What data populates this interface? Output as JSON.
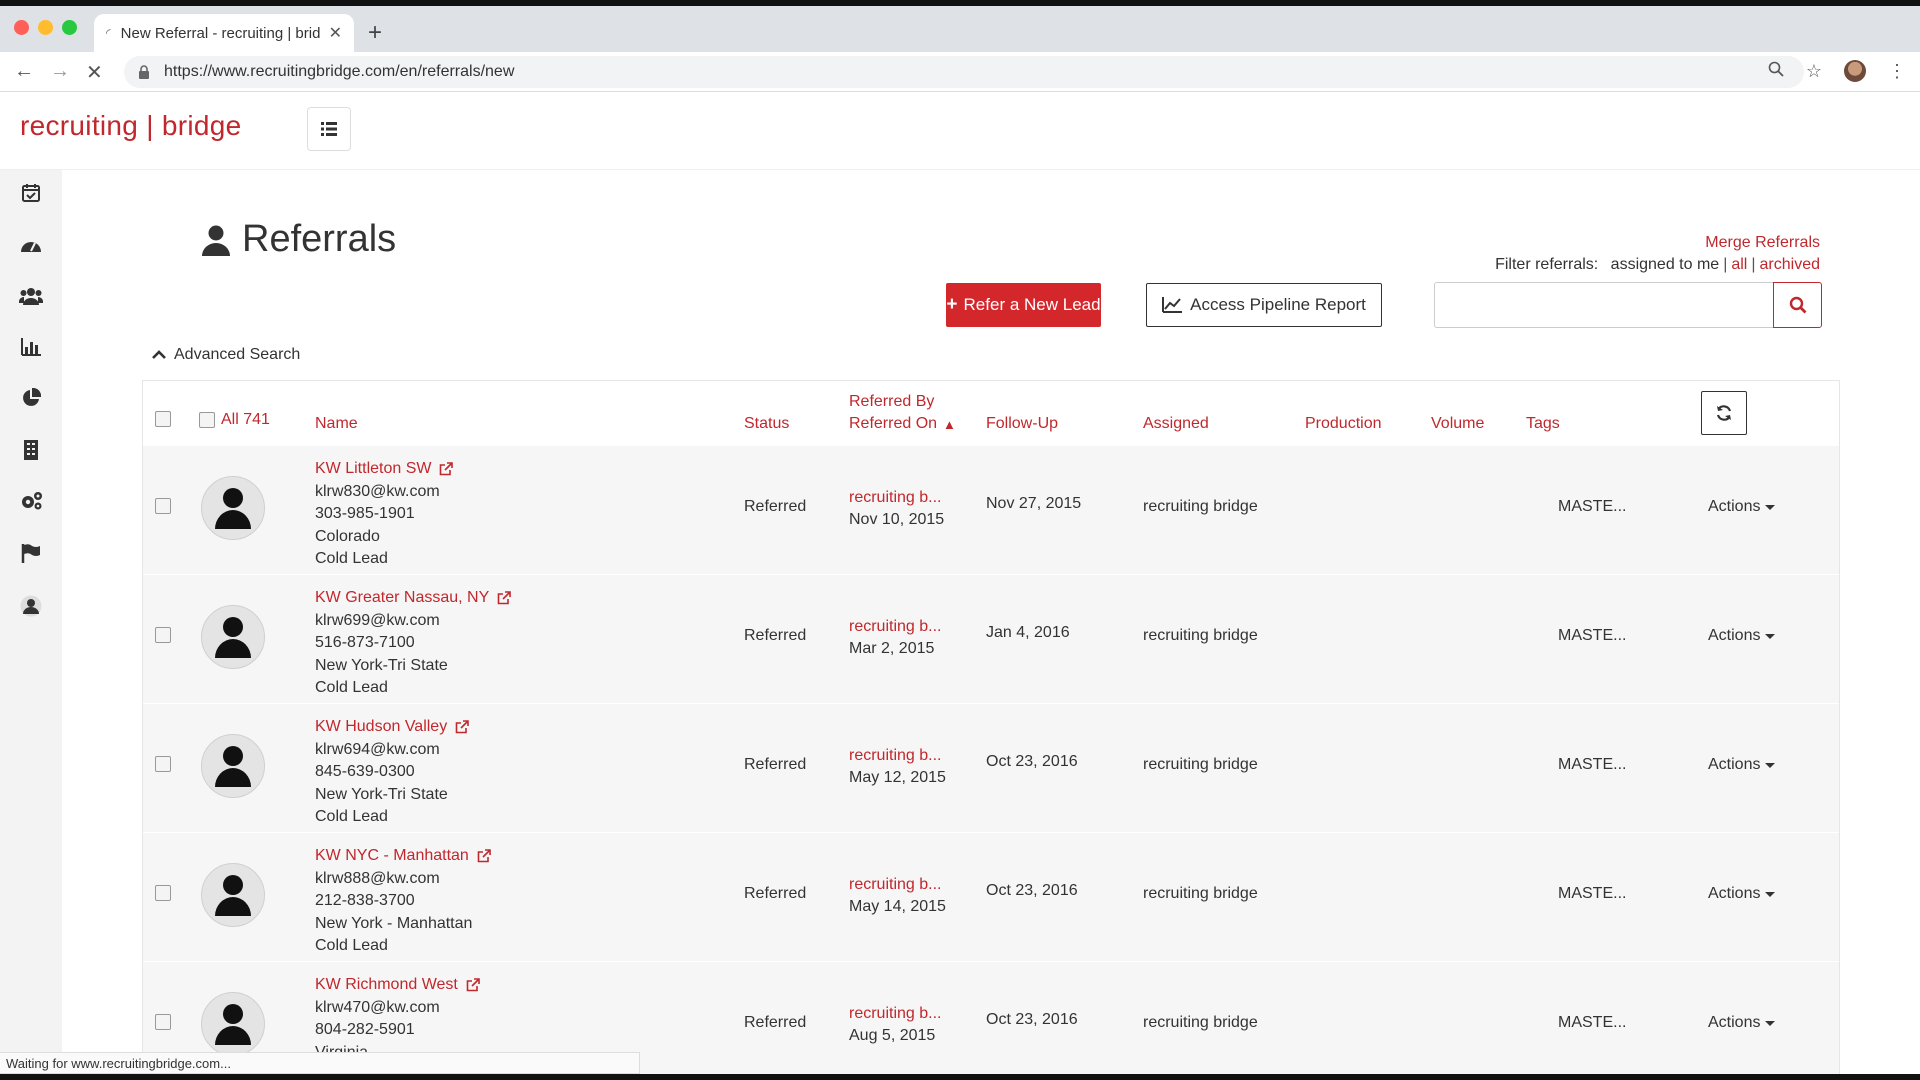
{
  "browser": {
    "tab_title": "New Referral - recruiting | brid",
    "url": "https://www.recruitingbridge.com/en/referrals/new",
    "status_text": "Waiting for www.recruitingbridge.com..."
  },
  "app": {
    "logo": "recruiting | bridge"
  },
  "sidebar": {
    "icons": [
      "calendar-check-icon",
      "dashboard-icon",
      "users-icon",
      "bar-chart-icon",
      "pie-chart-icon",
      "building-icon",
      "gears-icon",
      "flag-icon",
      "user-circle-icon"
    ]
  },
  "page": {
    "title": "Referrals",
    "merge_link": "Merge Referrals",
    "filter_label": "Filter referrals:",
    "filter_assigned": "assigned to me",
    "filter_all": "all",
    "filter_archived": "archived",
    "refer_button": "Refer a New Lead",
    "pipeline_button": "Access Pipeline Report",
    "search_placeholder": "",
    "advanced_search": "Advanced Search"
  },
  "table": {
    "all_label": "All 741",
    "headers": {
      "name": "Name",
      "status": "Status",
      "referred_by": "Referred By",
      "referred_on": "Referred On",
      "follow_up": "Follow-Up",
      "assigned": "Assigned",
      "production": "Production",
      "volume": "Volume",
      "tags": "Tags"
    },
    "rows": [
      {
        "name": "KW Littleton SW",
        "email": "klrw830@kw.com",
        "phone": "303-985-1901",
        "region": "Colorado",
        "lead_type": "Cold Lead",
        "status": "Referred",
        "referred_by": "recruiting b...",
        "referred_on": "Nov 10, 2015",
        "follow_up": "Nov 27, 2015",
        "assigned": "recruiting bridge",
        "tags": "MASTE...",
        "actions": "Actions"
      },
      {
        "name": "KW Greater Nassau, NY",
        "email": "klrw699@kw.com",
        "phone": "516-873-7100",
        "region": "New York-Tri State",
        "lead_type": "Cold Lead",
        "status": "Referred",
        "referred_by": "recruiting b...",
        "referred_on": "Mar 2, 2015",
        "follow_up": "Jan 4, 2016",
        "assigned": "recruiting bridge",
        "tags": "MASTE...",
        "actions": "Actions"
      },
      {
        "name": "KW Hudson Valley",
        "email": "klrw694@kw.com",
        "phone": "845-639-0300",
        "region": "New York-Tri State",
        "lead_type": "Cold Lead",
        "status": "Referred",
        "referred_by": "recruiting b...",
        "referred_on": "May 12, 2015",
        "follow_up": "Oct 23, 2016",
        "assigned": "recruiting bridge",
        "tags": "MASTE...",
        "actions": "Actions"
      },
      {
        "name": "KW NYC - Manhattan",
        "email": "klrw888@kw.com",
        "phone": "212-838-3700",
        "region": "New York - Manhattan",
        "lead_type": "Cold Lead",
        "status": "Referred",
        "referred_by": "recruiting b...",
        "referred_on": "May 14, 2015",
        "follow_up": "Oct 23, 2016",
        "assigned": "recruiting bridge",
        "tags": "MASTE...",
        "actions": "Actions"
      },
      {
        "name": "KW Richmond West",
        "email": "klrw470@kw.com",
        "phone": "804-282-5901",
        "region": "Virginia",
        "lead_type": "",
        "status": "Referred",
        "referred_by": "recruiting b...",
        "referred_on": "Aug 5, 2015",
        "follow_up": "Oct 23, 2016",
        "assigned": "recruiting bridge",
        "tags": "MASTE...",
        "actions": "Actions"
      }
    ]
  }
}
